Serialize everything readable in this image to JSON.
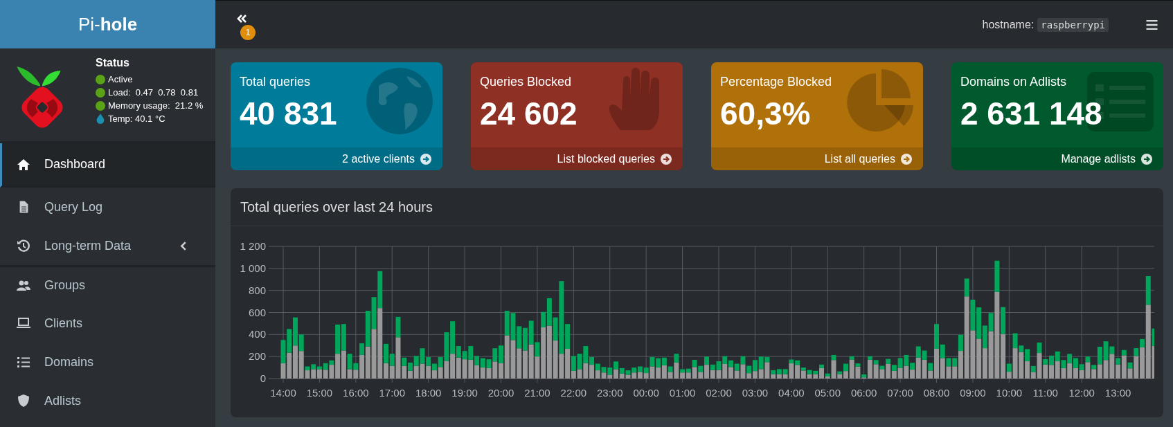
{
  "brand": {
    "name": "Pi-**hole**"
  },
  "status": {
    "title": "Status",
    "items": [
      {
        "kind": "dot",
        "text": "Active"
      },
      {
        "kind": "dot",
        "text": "Load:  0.47  0.78  0.81"
      },
      {
        "kind": "dot",
        "text": "Memory usage:  21.2 %"
      },
      {
        "kind": "temp",
        "text": "Temp: 40.1 °C"
      }
    ]
  },
  "sidebar": {
    "items": [
      {
        "label": "Dashboard",
        "selected": true,
        "kind": "link"
      },
      {
        "label": "Query Log",
        "selected": false,
        "kind": "link"
      },
      {
        "label": "Long-term Data",
        "selected": false,
        "kind": "group"
      },
      {
        "label": "Groups",
        "selected": false,
        "kind": "link"
      },
      {
        "label": "Clients",
        "selected": false,
        "kind": "link"
      },
      {
        "label": "Domains",
        "selected": false,
        "kind": "link"
      },
      {
        "label": "Adlists",
        "selected": false,
        "kind": "link"
      }
    ]
  },
  "topbar": {
    "notification_count": "1",
    "hostname_label": "hostname:",
    "hostname": "raspberrypi"
  },
  "cards": [
    {
      "title": "Total queries",
      "value": "40 831",
      "link": "2 active clients",
      "color": "#007c9a"
    },
    {
      "title": "Queries Blocked",
      "value": "24 602",
      "link": "List blocked queries",
      "color": "#8f3025"
    },
    {
      "title": "Percentage Blocked",
      "value": "60,3%",
      "link": "List all queries",
      "color": "#b0700a"
    },
    {
      "title": "Domains on Adlists",
      "value": "2 631 148",
      "link": "Manage adlists",
      "color": "#005a2d"
    }
  ],
  "chart": {
    "title": "Total queries over last 24 hours",
    "chart_data": {
      "type": "bar",
      "stacked": true,
      "grid": true,
      "ylim": [
        0,
        1200
      ],
      "categories": [
        "14:00",
        null,
        null,
        null,
        null,
        null,
        "15:00",
        null,
        null,
        null,
        null,
        null,
        "16:00",
        null,
        null,
        null,
        null,
        null,
        "17:00",
        null,
        null,
        null,
        null,
        null,
        "18:00",
        null,
        null,
        null,
        null,
        null,
        "19:00",
        null,
        null,
        null,
        null,
        null,
        "20:00",
        null,
        null,
        null,
        null,
        null,
        "21:00",
        null,
        null,
        null,
        null,
        null,
        "22:00",
        null,
        null,
        null,
        null,
        null,
        "23:00",
        null,
        null,
        null,
        null,
        null,
        "00:00",
        null,
        null,
        null,
        null,
        null,
        "01:00",
        null,
        null,
        null,
        null,
        null,
        "02:00",
        null,
        null,
        null,
        null,
        null,
        "03:00",
        null,
        null,
        null,
        null,
        null,
        "04:00",
        null,
        null,
        null,
        null,
        null,
        "05:00",
        null,
        null,
        null,
        null,
        null,
        "06:00",
        null,
        null,
        null,
        null,
        null,
        "07:00",
        null,
        null,
        null,
        null,
        null,
        "08:00",
        null,
        null,
        null,
        null,
        null,
        "09:00",
        null,
        null,
        null,
        null,
        null,
        "10:00",
        null,
        null,
        null,
        null,
        null,
        "11:00",
        null,
        null,
        null,
        null,
        null,
        "12:00",
        null,
        null,
        null,
        null,
        null,
        "13:00",
        null,
        null,
        null,
        null,
        null,
        null
      ],
      "yticks": [
        {
          "value": 0,
          "label": "0"
        },
        {
          "value": 200,
          "label": "200"
        },
        {
          "value": 400,
          "label": "400"
        },
        {
          "value": 600,
          "label": "600"
        },
        {
          "value": 800,
          "label": "800"
        },
        {
          "value": 1000,
          "label": "1 000"
        },
        {
          "value": 1200,
          "label": "1 200"
        }
      ],
      "series": [
        {
          "color": "#999999",
          "values": [
            140,
            235,
            300,
            250,
            75,
            85,
            85,
            80,
            125,
            225,
            255,
            85,
            80,
            215,
            290,
            450,
            640,
            140,
            115,
            375,
            115,
            70,
            115,
            135,
            115,
            75,
            105,
            160,
            225,
            190,
            175,
            170,
            120,
            100,
            95,
            155,
            140,
            390,
            350,
            275,
            255,
            310,
            200,
            465,
            480,
            345,
            225,
            270,
            70,
            85,
            140,
            125,
            75,
            55,
            35,
            85,
            45,
            35,
            55,
            60,
            50,
            110,
            100,
            120,
            60,
            145,
            55,
            55,
            105,
            60,
            125,
            78,
            78,
            132,
            105,
            73,
            130,
            49,
            68,
            86,
            149,
            40,
            40,
            40,
            138,
            124,
            73,
            40,
            40,
            95,
            19,
            168,
            40,
            68,
            173,
            108,
            11,
            170,
            130,
            86,
            132,
            70,
            97,
            116,
            81,
            189,
            170,
            73,
            270,
            186,
            111,
            111,
            251,
            746,
            438,
            362,
            276,
            430,
            786,
            405,
            62,
            276,
            241,
            157,
            59,
            232,
            127,
            124,
            157,
            95,
            138,
            97,
            76,
            149,
            86,
            130,
            168,
            224,
            127,
            211,
            92,
            205,
            284,
            670,
            297
          ]
        },
        {
          "color": "#00a65a",
          "values": [
            210,
            215,
            255,
            150,
            35,
            45,
            25,
            60,
            40,
            265,
            240,
            140,
            60,
            105,
            325,
            290,
            335,
            175,
            110,
            185,
            75,
            75,
            90,
            140,
            80,
            60,
            90,
            260,
            295,
            105,
            75,
            125,
            85,
            85,
            80,
            120,
            160,
            225,
            245,
            200,
            205,
            215,
            130,
            140,
            250,
            210,
            660,
            225,
            135,
            140,
            155,
            70,
            60,
            50,
            65,
            70,
            50,
            40,
            45,
            50,
            50,
            85,
            85,
            70,
            50,
            80,
            30,
            35,
            65,
            55,
            75,
            49,
            79,
            71,
            60,
            62,
            73,
            67,
            100,
            114,
            46,
            36,
            46,
            46,
            35,
            41,
            27,
            38,
            30,
            32,
            27,
            46,
            25,
            67,
            30,
            30,
            27,
            33,
            38,
            30,
            46,
            54,
            89,
            98,
            62,
            103,
            84,
            68,
            225,
            123,
            75,
            75,
            146,
            162,
            278,
            284,
            205,
            165,
            284,
            244,
            73,
            135,
            59,
            111,
            55,
            95,
            49,
            84,
            89,
            73,
            86,
            89,
            54,
            51,
            38,
            159,
            170,
            68,
            59,
            48,
            54,
            71,
            75,
            260,
            157
          ]
        }
      ]
    }
  }
}
